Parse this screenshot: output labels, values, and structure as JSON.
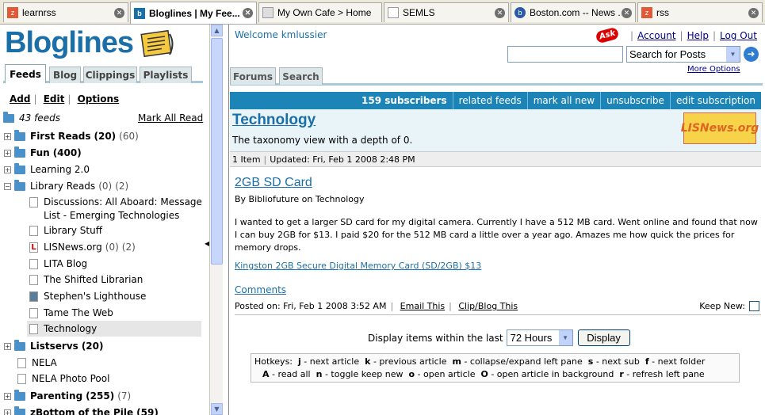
{
  "browser_tabs": [
    {
      "title": "learnrss",
      "favicon": "z"
    },
    {
      "title": "Bloglines | My Fee...",
      "favicon": "b",
      "active": true
    },
    {
      "title": "My Own Cafe > Home",
      "favicon": "page"
    },
    {
      "title": "SEMLS",
      "favicon": "page"
    },
    {
      "title": "Boston.com -- News ...",
      "favicon": "b"
    },
    {
      "title": "rss",
      "favicon": "z"
    }
  ],
  "left": {
    "logo": "Bloglines",
    "tabs": [
      "Feeds",
      "Blog",
      "Clippings",
      "Playlists"
    ],
    "actions": [
      "Add",
      "Edit",
      "Options"
    ],
    "feeds_count": "43 feeds",
    "mark_all_read": "Mark All Read",
    "tree": [
      {
        "label": "First Reads",
        "count": "(20)",
        "extra": "(60)",
        "type": "folder",
        "bold": true
      },
      {
        "label": "Fun",
        "count": "(400)",
        "extra": "",
        "type": "folder",
        "bold": true
      },
      {
        "label": "Learning 2.0",
        "count": "",
        "extra": "",
        "type": "folder",
        "bold": false
      },
      {
        "label": "Library Reads",
        "count": "(0)",
        "extra": "(2)",
        "type": "folder-open",
        "bold": false
      },
      {
        "label": "Discussions: All Aboard: Message",
        "label2": "List - Emerging Technologies",
        "type": "doc"
      },
      {
        "label": "Library Stuff",
        "type": "doc"
      },
      {
        "label": "LISNews.org",
        "count": "(0)",
        "extra": "(2)",
        "type": "doc-l"
      },
      {
        "label": "LITA Blog",
        "type": "doc"
      },
      {
        "label": "The Shifted Librarian",
        "type": "doc"
      },
      {
        "label": "Stephen's Lighthouse",
        "type": "doc-img"
      },
      {
        "label": "Tame The Web",
        "type": "doc"
      },
      {
        "label": "Technology",
        "type": "doc",
        "selected": true
      },
      {
        "label": "Listservs",
        "count": "(20)",
        "extra": "",
        "type": "folder",
        "bold": true
      },
      {
        "label": "NELA",
        "type": "doc"
      },
      {
        "label": "NELA Photo Pool",
        "type": "doc"
      },
      {
        "label": "Parenting",
        "count": "(255)",
        "extra": "(7)",
        "type": "folder",
        "bold": true
      },
      {
        "label": "zBottom of the Pile",
        "count": "(59)",
        "extra": "",
        "type": "folder",
        "bold": true
      }
    ]
  },
  "header": {
    "welcome": "Welcome kmlussier",
    "ask": "Ask",
    "links": [
      "Account",
      "Help",
      "Log Out"
    ],
    "search_value": "",
    "search_select": "Search for Posts",
    "more_options": "More Options"
  },
  "right_tabs": [
    "Forums",
    "Search"
  ],
  "feedbar": [
    "159 subscribers",
    "related feeds",
    "mark all new",
    "unsubscribe",
    "edit subscription"
  ],
  "feed": {
    "title": "Technology",
    "description": "The taxonomy view with a depth of 0.",
    "badge": "LISNews.org",
    "items": "1 Item",
    "updated": "Updated: Fri, Feb 1 2008 2:48 PM"
  },
  "post": {
    "title": "2GB SD Card",
    "byline": "By Bibliofuture on Technology",
    "body": "I wanted to get a larger SD card for my digital camera. Currently I have a 512 MB card. Went online and found that now I can buy 2GB for $13. I paid $20 for the 512 MB card a little over a year ago. Amazes me how quick the prices for memory drops.",
    "link": "Kingston 2GB Secure Digital Memory Card (SD/2GB) $13",
    "comments": "Comments",
    "posted": "Posted on: Fri, Feb 1 2008 3:52 AM",
    "email": "Email This",
    "clip": "Clip/Blog This",
    "keep_new": "Keep New:"
  },
  "display": {
    "label": "Display items within the last",
    "value": "72 Hours",
    "button": "Display"
  },
  "hotkeys": {
    "line1": [
      {
        "k": "Hotkeys:",
        "d": ""
      },
      {
        "k": "j",
        "d": "- next article"
      },
      {
        "k": "k",
        "d": "- previous article"
      },
      {
        "k": "m",
        "d": "- collapse/expand left pane"
      },
      {
        "k": "s",
        "d": "- next sub"
      },
      {
        "k": "f",
        "d": "- next folder"
      }
    ],
    "line2": [
      {
        "k": "A",
        "d": "- read all"
      },
      {
        "k": "n",
        "d": "- toggle keep new"
      },
      {
        "k": "o",
        "d": "- open article"
      },
      {
        "k": "O",
        "d": "- open article in background"
      },
      {
        "k": "r",
        "d": "- refresh left pane"
      }
    ]
  }
}
